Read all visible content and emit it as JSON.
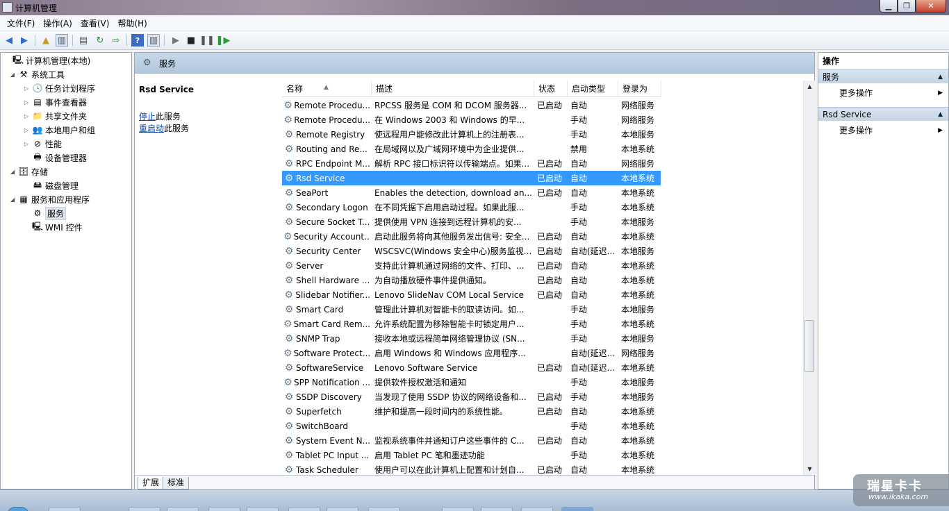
{
  "window": {
    "title": "计算机管理",
    "min_label": "▁",
    "max_label": "❐",
    "close_label": "✕"
  },
  "menu": [
    "文件(F)",
    "操作(A)",
    "查看(V)",
    "帮助(H)"
  ],
  "tree": [
    {
      "label": "计算机管理(本地)",
      "icon": "computer-icon",
      "glyph": "🖳",
      "level": 0,
      "arrow": ""
    },
    {
      "label": "系统工具",
      "icon": "tools-icon",
      "glyph": "⚒",
      "level": 1,
      "arrow": "◢"
    },
    {
      "label": "任务计划程序",
      "icon": "clock-icon",
      "glyph": "🕓",
      "level": 2,
      "arrow": "▷"
    },
    {
      "label": "事件查看器",
      "icon": "event-viewer-icon",
      "glyph": "▤",
      "level": 2,
      "arrow": "▷"
    },
    {
      "label": "共享文件夹",
      "icon": "shared-folder-icon",
      "glyph": "📁",
      "level": 2,
      "arrow": "▷"
    },
    {
      "label": "本地用户和组",
      "icon": "users-icon",
      "glyph": "👥",
      "level": 2,
      "arrow": "▷"
    },
    {
      "label": "性能",
      "icon": "performance-icon",
      "glyph": "⊘",
      "level": 2,
      "arrow": "▷"
    },
    {
      "label": "设备管理器",
      "icon": "device-manager-icon",
      "glyph": "🖶",
      "level": 2,
      "arrow": ""
    },
    {
      "label": "存储",
      "icon": "storage-icon",
      "glyph": "🗄",
      "level": 1,
      "arrow": "◢"
    },
    {
      "label": "磁盘管理",
      "icon": "disk-icon",
      "glyph": "🖴",
      "level": 2,
      "arrow": ""
    },
    {
      "label": "服务和应用程序",
      "icon": "services-apps-icon",
      "glyph": "▦",
      "level": 1,
      "arrow": "◢"
    },
    {
      "label": "服务",
      "icon": "services-gear-icon",
      "glyph": "⚙",
      "level": 2,
      "arrow": "",
      "selected": true
    },
    {
      "label": "WMI 控件",
      "icon": "wmi-icon",
      "glyph": "🖳",
      "level": 2,
      "arrow": ""
    }
  ],
  "center": {
    "header_title": "服务",
    "selected_service": "Rsd Service",
    "stop_link": "停止",
    "stop_suffix": "此服务",
    "restart_link": "重启动",
    "restart_suffix": "此服务"
  },
  "columns": [
    "名称",
    "描述",
    "状态",
    "启动类型",
    "登录为"
  ],
  "services": [
    {
      "name": "Remote Procedu...",
      "desc": "RPCSS 服务是 COM 和 DCOM 服务器...",
      "status": "已启动",
      "startup": "自动",
      "logon": "网络服务"
    },
    {
      "name": "Remote Procedu...",
      "desc": "在 Windows 2003 和 Windows 的早...",
      "status": "",
      "startup": "手动",
      "logon": "网络服务"
    },
    {
      "name": "Remote Registry",
      "desc": "使远程用户能修改此计算机上的注册表...",
      "status": "",
      "startup": "手动",
      "logon": "本地服务"
    },
    {
      "name": "Routing and Re...",
      "desc": "在局域网以及广域网环境中为企业提供...",
      "status": "",
      "startup": "禁用",
      "logon": "本地系统"
    },
    {
      "name": "RPC Endpoint M...",
      "desc": "解析 RPC 接口标识符以传输端点。如果...",
      "status": "已启动",
      "startup": "自动",
      "logon": "网络服务"
    },
    {
      "name": "Rsd Service",
      "desc": "",
      "status": "已启动",
      "startup": "自动",
      "logon": "本地系统",
      "selected": true
    },
    {
      "name": "SeaPort",
      "desc": "Enables the detection, download an...",
      "status": "已启动",
      "startup": "自动",
      "logon": "本地系统"
    },
    {
      "name": "Secondary Logon",
      "desc": "在不同凭据下启用启动过程。如果此服...",
      "status": "",
      "startup": "手动",
      "logon": "本地系统"
    },
    {
      "name": "Secure Socket T...",
      "desc": "提供使用 VPN 连接到远程计算机的安...",
      "status": "",
      "startup": "手动",
      "logon": "本地服务"
    },
    {
      "name": "Security Account...",
      "desc": "启动此服务将向其他服务发出信号: 安全...",
      "status": "已启动",
      "startup": "自动",
      "logon": "本地系统"
    },
    {
      "name": "Security Center",
      "desc": "WSCSVC(Windows 安全中心)服务监视...",
      "status": "已启动",
      "startup": "自动(延迟...",
      "logon": "本地服务"
    },
    {
      "name": "Server",
      "desc": "支持此计算机通过网络的文件、打印、...",
      "status": "已启动",
      "startup": "自动",
      "logon": "本地系统"
    },
    {
      "name": "Shell Hardware ...",
      "desc": "为自动播放硬件事件提供通知。",
      "status": "已启动",
      "startup": "自动",
      "logon": "本地系统"
    },
    {
      "name": "Slidebar Notifier...",
      "desc": "Lenovo SlideNav COM Local Service",
      "status": "已启动",
      "startup": "自动",
      "logon": "本地系统"
    },
    {
      "name": "Smart Card",
      "desc": "管理此计算机对智能卡的取读访问。如...",
      "status": "",
      "startup": "手动",
      "logon": "本地服务"
    },
    {
      "name": "Smart Card Rem...",
      "desc": "允许系统配置为移除智能卡时锁定用户...",
      "status": "",
      "startup": "手动",
      "logon": "本地系统"
    },
    {
      "name": "SNMP Trap",
      "desc": "接收本地或远程简单网络管理协议 (SN...",
      "status": "",
      "startup": "手动",
      "logon": "本地服务"
    },
    {
      "name": "Software Protect...",
      "desc": "启用 Windows 和 Windows 应用程序...",
      "status": "",
      "startup": "自动(延迟...",
      "logon": "网络服务"
    },
    {
      "name": "SoftwareService",
      "desc": "Lenovo Software Service",
      "status": "已启动",
      "startup": "自动(延迟...",
      "logon": "本地系统"
    },
    {
      "name": "SPP Notification ...",
      "desc": "提供软件授权激活和通知",
      "status": "",
      "startup": "手动",
      "logon": "本地服务"
    },
    {
      "name": "SSDP Discovery",
      "desc": "当发现了使用 SSDP 协议的网络设备和...",
      "status": "已启动",
      "startup": "手动",
      "logon": "本地服务"
    },
    {
      "name": "Superfetch",
      "desc": "维护和提高一段时间内的系统性能。",
      "status": "已启动",
      "startup": "自动",
      "logon": "本地系统"
    },
    {
      "name": "SwitchBoard",
      "desc": "",
      "status": "",
      "startup": "手动",
      "logon": "本地系统"
    },
    {
      "name": "System Event N...",
      "desc": "监视系统事件并通知订户这些事件的 C...",
      "status": "已启动",
      "startup": "自动",
      "logon": "本地系统"
    },
    {
      "name": "Tablet PC Input ...",
      "desc": "启用 Tablet PC 笔和墨迹功能",
      "status": "",
      "startup": "手动",
      "logon": "本地系统"
    },
    {
      "name": "Task Scheduler",
      "desc": "使用户可以在此计算机上配置和计划自...",
      "status": "已启动",
      "startup": "自动",
      "logon": "本地系统"
    }
  ],
  "tabs": [
    "扩展",
    "标准"
  ],
  "actions": {
    "header": "操作",
    "sections": [
      {
        "title": "服务",
        "item": "更多操作"
      },
      {
        "title": "Rsd Service",
        "item": "更多操作"
      }
    ]
  },
  "watermark": {
    "line1": "瑞星卡卡",
    "line2": "www.ikaka.com"
  }
}
